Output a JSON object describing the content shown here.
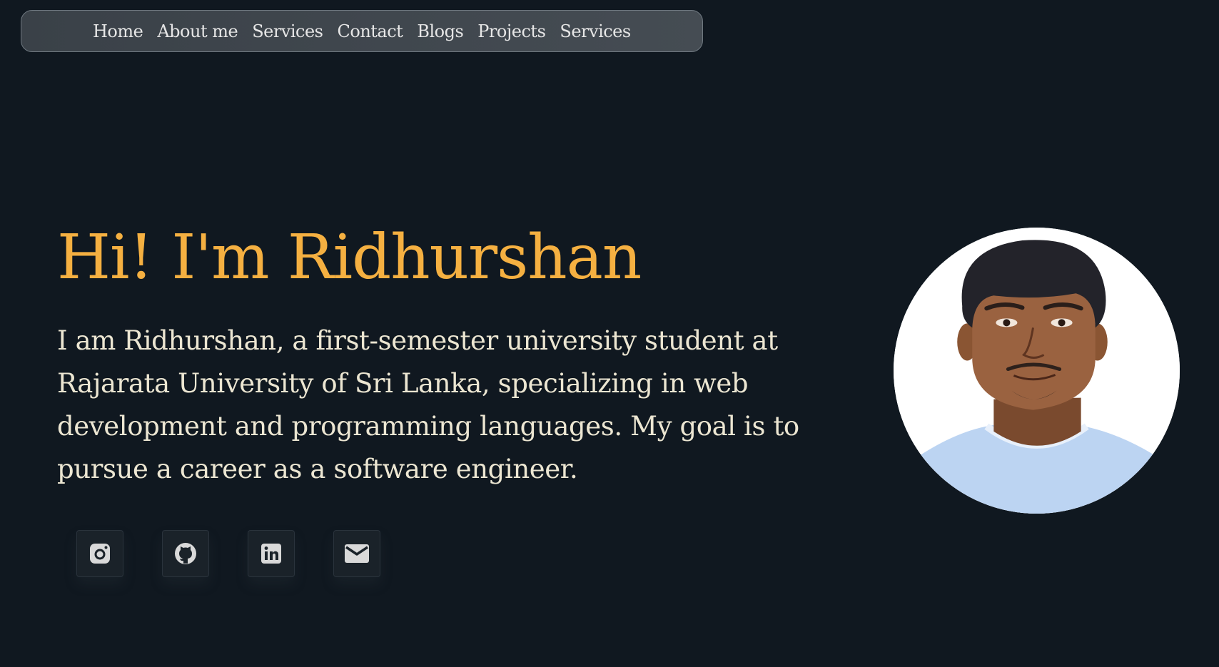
{
  "nav": {
    "items": [
      {
        "label": "Home"
      },
      {
        "label": "About me"
      },
      {
        "label": "Services"
      },
      {
        "label": "Contact"
      },
      {
        "label": "Blogs"
      },
      {
        "label": "Projects"
      },
      {
        "label": "Services"
      }
    ]
  },
  "hero": {
    "title": "Hi! I'm Ridhurshan",
    "description": "I am Ridhurshan, a first-semester university student at Rajarata University of Sri Lanka, specializing in web development and programming languages. My goal is to pursue a career as a software engineer."
  },
  "avatar": {
    "icon": "profile-photo"
  },
  "socials": [
    {
      "icon": "instagram-icon"
    },
    {
      "icon": "github-icon"
    },
    {
      "icon": "linkedin-icon"
    },
    {
      "icon": "mail-icon"
    }
  ],
  "colors": {
    "background": "#101820",
    "accent": "#f5b041",
    "text": "#ece6d2",
    "nav_bg": "#40474e"
  }
}
